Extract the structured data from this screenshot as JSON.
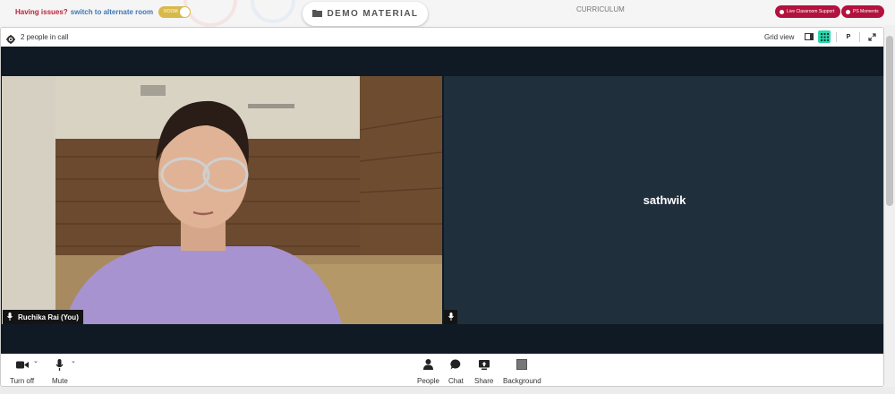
{
  "topbar": {
    "issues_text": "Having issues?",
    "switch_link": "switch to alternate room",
    "room_toggle_label": "ROOM",
    "demo_label": "DEMO MATERIAL",
    "curriculum_label": "CURRICULUM",
    "live_support_label": "Live Classroom Support",
    "ps_moments_label": "PS Moments"
  },
  "callbar": {
    "people_count": "2 people in call",
    "grid_view_label": "Grid view",
    "pin_label": "P"
  },
  "tiles": {
    "self_name": "Ruchika Rai (You)",
    "other_name": "sathwik"
  },
  "controls": {
    "camera_label": "Turn off",
    "mic_label": "Mute",
    "people_label": "People",
    "chat_label": "Chat",
    "share_label": "Share",
    "background_label": "Background"
  },
  "colors": {
    "accent_red": "#b3123e",
    "grid_active": "#2ad8b0",
    "stage_bg": "#0f1a24",
    "tile_bg": "#202f3c"
  }
}
